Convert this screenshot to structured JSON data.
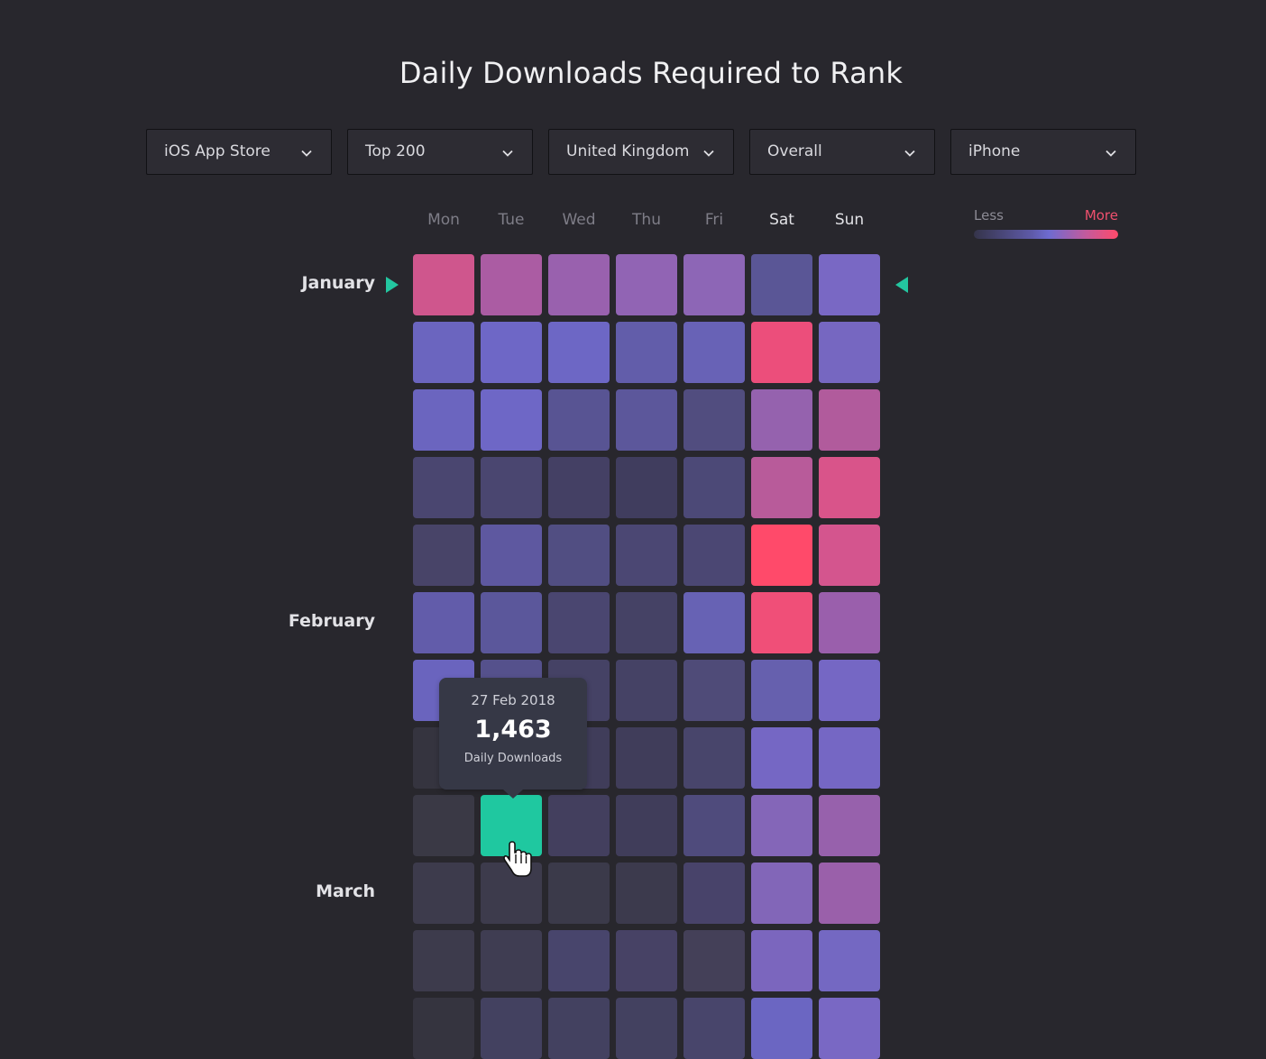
{
  "title": "Daily Downloads Required to Rank",
  "filters": [
    {
      "name": "store",
      "value": "iOS App Store",
      "icon": "chevron-down-icon"
    },
    {
      "name": "rank",
      "value": "Top 200",
      "icon": "chevron-down-icon"
    },
    {
      "name": "country",
      "value": "United Kingdom",
      "icon": "chevron-down-icon"
    },
    {
      "name": "category",
      "value": "Overall",
      "icon": "chevron-down-icon"
    },
    {
      "name": "device",
      "value": "iPhone",
      "icon": "chevron-down-icon"
    }
  ],
  "legend": {
    "less": "Less",
    "more": "More",
    "low_color": "#35344a",
    "mid_color": "#6e6bd0",
    "high_color": "#ff4a6a"
  },
  "colors": {
    "background": "#28272d",
    "highlight": "#1fc8a0",
    "marker": "#23c6a0",
    "tooltip_bg": "#363846"
  },
  "tooltip": {
    "date": "27 Feb 2018",
    "value": "1,463",
    "label": "Daily Downloads"
  },
  "months": [
    {
      "label": "January",
      "row": 0
    },
    {
      "label": "February",
      "row": 5
    },
    {
      "label": "March",
      "row": 9
    }
  ],
  "chart_data": {
    "type": "heatmap",
    "title": "Daily Downloads Required to Rank",
    "x": [
      "Mon",
      "Tue",
      "Wed",
      "Thu",
      "Fri",
      "Sat",
      "Sun"
    ],
    "weekend_highlight": [
      "Sat",
      "Sun"
    ],
    "y_labels": [
      "January",
      "",
      "",
      "",
      "",
      "February",
      "",
      "",
      "",
      "March",
      "",
      ""
    ],
    "scale": {
      "min_label": "Less",
      "max_label": "More",
      "range": [
        0,
        1
      ]
    },
    "selected": {
      "row": 8,
      "col": 1,
      "date": "27 Feb 2018",
      "value": 1463,
      "unit": "Daily Downloads"
    },
    "current_week_row": 0,
    "intensity": [
      [
        0.9,
        0.8,
        0.75,
        0.72,
        0.7,
        0.4,
        0.55
      ],
      [
        0.5,
        0.52,
        0.52,
        0.42,
        0.46,
        0.97,
        0.56
      ],
      [
        0.5,
        0.52,
        0.32,
        0.36,
        0.26,
        0.72,
        0.82
      ],
      [
        0.18,
        0.18,
        0.14,
        0.12,
        0.2,
        0.82,
        0.92
      ],
      [
        0.16,
        0.38,
        0.26,
        0.2,
        0.18,
        1.0,
        0.9
      ],
      [
        0.42,
        0.34,
        0.18,
        0.14,
        0.45,
        0.97,
        0.75
      ],
      [
        0.5,
        0.3,
        0.14,
        0.16,
        0.24,
        0.42,
        0.55
      ],
      [
        0.04,
        0.08,
        0.08,
        0.1,
        0.16,
        0.58,
        0.56
      ],
      [
        0.06,
        null,
        0.14,
        0.12,
        0.26,
        0.64,
        0.74
      ],
      [
        0.06,
        0.06,
        0.06,
        0.08,
        0.16,
        0.66,
        0.76
      ],
      [
        0.06,
        0.08,
        0.2,
        0.16,
        0.1,
        0.62,
        0.56
      ],
      [
        0.02,
        0.12,
        0.12,
        0.1,
        0.18,
        0.5,
        0.58
      ]
    ],
    "cell_colors": [
      [
        "#cf568d",
        "#ab5ca3",
        "#9961ae",
        "#9164b4",
        "#8d66b6",
        "#5a5696",
        "#7968c4"
      ],
      [
        "#6b65bf",
        "#6e67c6",
        "#6d67c5",
        "#625daa",
        "#6862b6",
        "#ec4e7b",
        "#7667c1"
      ],
      [
        "#6b65bf",
        "#6e67c6",
        "#585493",
        "#5c579b",
        "#514d7f",
        "#9562ae",
        "#b15b9c"
      ],
      [
        "#4a4670",
        "#4a4670",
        "#444064",
        "#403d5e",
        "#4c4977",
        "#b85b9a",
        "#d9548a"
      ],
      [
        "#484468",
        "#5e58a0",
        "#514e82",
        "#4b4773",
        "#4b4773",
        "#ff4a6a",
        "#d4558e"
      ],
      [
        "#625caa",
        "#5b579b",
        "#4a4670",
        "#454265",
        "#6762b4",
        "#f04f78",
        "#9a5fac"
      ],
      [
        "#6a64be",
        "#55518c",
        "#454265",
        "#454265",
        "#4f4b78",
        "#6660ae",
        "#7567c4"
      ],
      [
        "#35343f",
        "#3f3d56",
        "#403d5a",
        "#403d5a",
        "#48456b",
        "#7567c4",
        "#7567c4"
      ],
      [
        "#3a3945",
        "#1fc8a0",
        "#433f5e",
        "#403d5a",
        "#4f4b7c",
        "#8466b8",
        "#9761ac"
      ],
      [
        "#3d3b4c",
        "#3d3b4c",
        "#3b3a4a",
        "#3c3a4d",
        "#48436a",
        "#8266b8",
        "#9a60aa"
      ],
      [
        "#3d3b4c",
        "#3f3d52",
        "#48456c",
        "#474265",
        "#444058",
        "#7b66be",
        "#7468c2"
      ],
      [
        "#35343f",
        "#434160",
        "#434160",
        "#434160",
        "#48456b",
        "#6b66c2",
        "#7968c4"
      ]
    ]
  }
}
